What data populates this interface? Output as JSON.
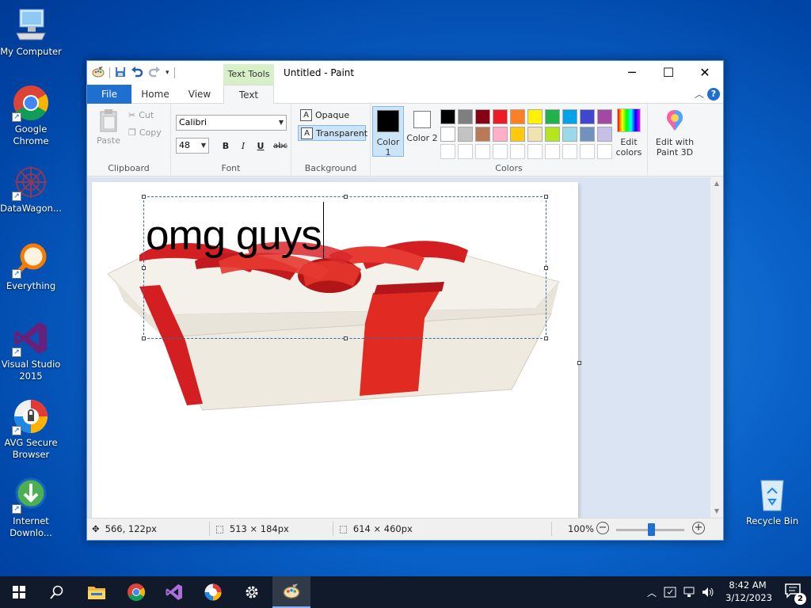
{
  "desktop": {
    "icons": [
      {
        "label": "My Computer"
      },
      {
        "label": "Google Chrome"
      },
      {
        "label": "DataWagon..."
      },
      {
        "label": "Everything"
      },
      {
        "label": "Visual Studio 2015"
      },
      {
        "label": "AVG Secure Browser"
      },
      {
        "label": "Internet Downlo..."
      },
      {
        "label": "Recycle Bin"
      }
    ]
  },
  "window": {
    "title": "Untitled - Paint",
    "context_tab": "Text Tools",
    "tabs": [
      "File",
      "Home",
      "View",
      "Text"
    ],
    "active_tab": "Text"
  },
  "ribbon": {
    "clipboard": {
      "paste": "Paste",
      "cut": "Cut",
      "copy": "Copy",
      "label": "Clipboard"
    },
    "font": {
      "family": "Calibri",
      "size": "48",
      "bold": "B",
      "italic": "I",
      "underline": "U",
      "strikethrough": "abc",
      "label": "Font"
    },
    "background": {
      "opaque": "Opaque",
      "transparent": "Transparent",
      "selected": "Transparent",
      "label": "Background"
    },
    "colors": {
      "color1_label": "Color 1",
      "color2_label": "Color 2",
      "color1": "#000000",
      "color2": "#ffffff",
      "palette_row1": [
        "#000000",
        "#7f7f7f",
        "#880015",
        "#ed1c24",
        "#ff7f27",
        "#fff200",
        "#22b14c",
        "#00a2e8",
        "#3f48cc",
        "#a349a4"
      ],
      "palette_row2": [
        "#ffffff",
        "#c3c3c3",
        "#b97a57",
        "#ffaec9",
        "#ffc90e",
        "#efe4b0",
        "#b5e61d",
        "#99d9ea",
        "#7092be",
        "#c8bfe7"
      ],
      "palette_row3": [
        "#ffffff",
        "#ffffff",
        "#ffffff",
        "#ffffff",
        "#ffffff",
        "#ffffff",
        "#ffffff",
        "#ffffff",
        "#ffffff",
        "#ffffff"
      ],
      "edit_colors": "Edit colors",
      "label": "Colors"
    },
    "paint3d": "Edit with Paint 3D"
  },
  "canvas": {
    "text": "omg guys"
  },
  "status": {
    "cursor_pos": "566, 122px",
    "selection_size": "513 × 184px",
    "image_size": "614 × 460px",
    "zoom": "100%"
  },
  "taskbar": {
    "time": "8:42 AM",
    "date": "3/12/2023",
    "notification_count": "2"
  }
}
